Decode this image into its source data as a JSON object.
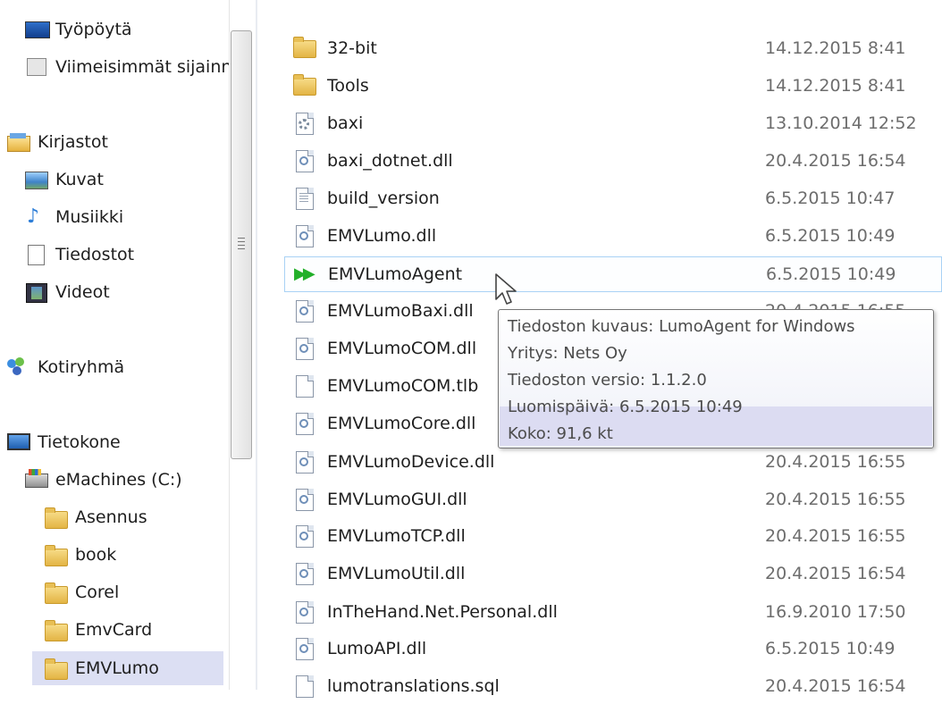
{
  "nav": {
    "items": [
      {
        "label": "Työpöytä",
        "icon": "desktop-icon"
      },
      {
        "label": "Viimeisimmät sijainnit",
        "icon": "recent-places-icon"
      },
      {
        "label": "Kirjastot",
        "icon": "libraries-icon"
      },
      {
        "label": "Kuvat",
        "icon": "pictures-icon"
      },
      {
        "label": "Musiikki",
        "icon": "music-icon"
      },
      {
        "label": "Tiedostot",
        "icon": "documents-icon"
      },
      {
        "label": "Videot",
        "icon": "videos-icon"
      },
      {
        "label": "Kotiryhmä",
        "icon": "homegroup-icon"
      },
      {
        "label": "Tietokone",
        "icon": "computer-icon"
      },
      {
        "label": "eMachines (C:)",
        "icon": "drive-icon"
      },
      {
        "label": "Asennus",
        "icon": "folder-icon"
      },
      {
        "label": "book",
        "icon": "folder-icon"
      },
      {
        "label": "Corel",
        "icon": "folder-icon"
      },
      {
        "label": "EmvCard",
        "icon": "folder-icon"
      },
      {
        "label": "EMVLumo",
        "icon": "folder-icon"
      }
    ],
    "selected": "EMVLumo"
  },
  "files": [
    {
      "name": "32-bit",
      "date": "14.12.2015 8:41",
      "icon": "folder-icon"
    },
    {
      "name": "Tools",
      "date": "14.12.2015 8:41",
      "icon": "folder-icon"
    },
    {
      "name": "baxi",
      "date": "13.10.2014 12:52",
      "icon": "config-file-icon"
    },
    {
      "name": "baxi_dotnet.dll",
      "date": "20.4.2015 16:54",
      "icon": "dll-file-icon"
    },
    {
      "name": "build_version",
      "date": "6.5.2015 10:47",
      "icon": "text-file-icon"
    },
    {
      "name": "EMVLumo.dll",
      "date": "6.5.2015 10:49",
      "icon": "dll-file-icon"
    },
    {
      "name": "EMVLumoAgent",
      "date": "6.5.2015 10:49",
      "icon": "application-icon"
    },
    {
      "name": "EMVLumoBaxi.dll",
      "date": "20.4.2015 16:55",
      "icon": "dll-file-icon"
    },
    {
      "name": "EMVLumoCOM.dll",
      "date": "",
      "icon": "dll-file-icon"
    },
    {
      "name": "EMVLumoCOM.tlb",
      "date": "",
      "icon": "blank-file-icon"
    },
    {
      "name": "EMVLumoCore.dll",
      "date": "",
      "icon": "dll-file-icon"
    },
    {
      "name": "EMVLumoDevice.dll",
      "date": "20.4.2015 16:55",
      "icon": "dll-file-icon"
    },
    {
      "name": "EMVLumoGUI.dll",
      "date": "20.4.2015 16:55",
      "icon": "dll-file-icon"
    },
    {
      "name": "EMVLumoTCP.dll",
      "date": "20.4.2015 16:55",
      "icon": "dll-file-icon"
    },
    {
      "name": "EMVLumoUtil.dll",
      "date": "20.4.2015 16:54",
      "icon": "dll-file-icon"
    },
    {
      "name": "InTheHand.Net.Personal.dll",
      "date": "16.9.2010 17:50",
      "icon": "dll-file-icon"
    },
    {
      "name": "LumoAPI.dll",
      "date": "6.5.2015 10:49",
      "icon": "dll-file-icon"
    },
    {
      "name": "lumotranslations.sql",
      "date": "20.4.2015 16:54",
      "icon": "blank-file-icon"
    }
  ],
  "hovered_file": "EMVLumoAgent",
  "tooltip": {
    "description": "Tiedoston kuvaus: LumoAgent for Windows",
    "company": "Yritys: Nets Oy",
    "version": "Tiedoston versio: 1.1.2.0",
    "created": "Luomispäivä: 6.5.2015 10:49",
    "size": "Koko: 91,6 kt"
  },
  "colors": {
    "selection": "#dcdff3",
    "hover_border": "#a9d2f5",
    "date_text": "#6d6d6d",
    "tooltip_highlight": "#dcdcf2"
  }
}
